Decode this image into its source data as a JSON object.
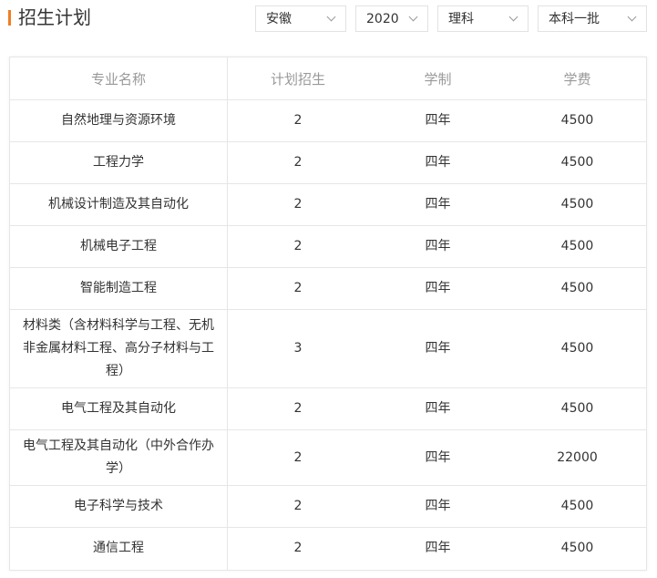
{
  "page_title": "招生计划",
  "filters": {
    "province": "安徽",
    "year": "2020",
    "subject": "理科",
    "batch": "本科一批"
  },
  "table": {
    "headers": [
      "专业名称",
      "计划招生",
      "学制",
      "学费"
    ],
    "rows": [
      {
        "major": "自然地理与资源环境",
        "plan": "2",
        "duration": "四年",
        "fee": "4500"
      },
      {
        "major": "工程力学",
        "plan": "2",
        "duration": "四年",
        "fee": "4500"
      },
      {
        "major": "机械设计制造及其自动化",
        "plan": "2",
        "duration": "四年",
        "fee": "4500"
      },
      {
        "major": "机械电子工程",
        "plan": "2",
        "duration": "四年",
        "fee": "4500"
      },
      {
        "major": "智能制造工程",
        "plan": "2",
        "duration": "四年",
        "fee": "4500"
      },
      {
        "major": "材料类（含材料科学与工程、无机非金属材料工程、高分子材料与工程）",
        "plan": "3",
        "duration": "四年",
        "fee": "4500"
      },
      {
        "major": "电气工程及其自动化",
        "plan": "2",
        "duration": "四年",
        "fee": "4500"
      },
      {
        "major": "电气工程及其自动化（中外合作办学）",
        "plan": "2",
        "duration": "四年",
        "fee": "22000"
      },
      {
        "major": "电子科学与技术",
        "plan": "2",
        "duration": "四年",
        "fee": "4500"
      },
      {
        "major": "通信工程",
        "plan": "2",
        "duration": "四年",
        "fee": "4500"
      }
    ]
  },
  "colors": {
    "accent": "#f27c22",
    "header_text": "#999999",
    "body_text": "#333333",
    "border": "#e6e6e6"
  }
}
